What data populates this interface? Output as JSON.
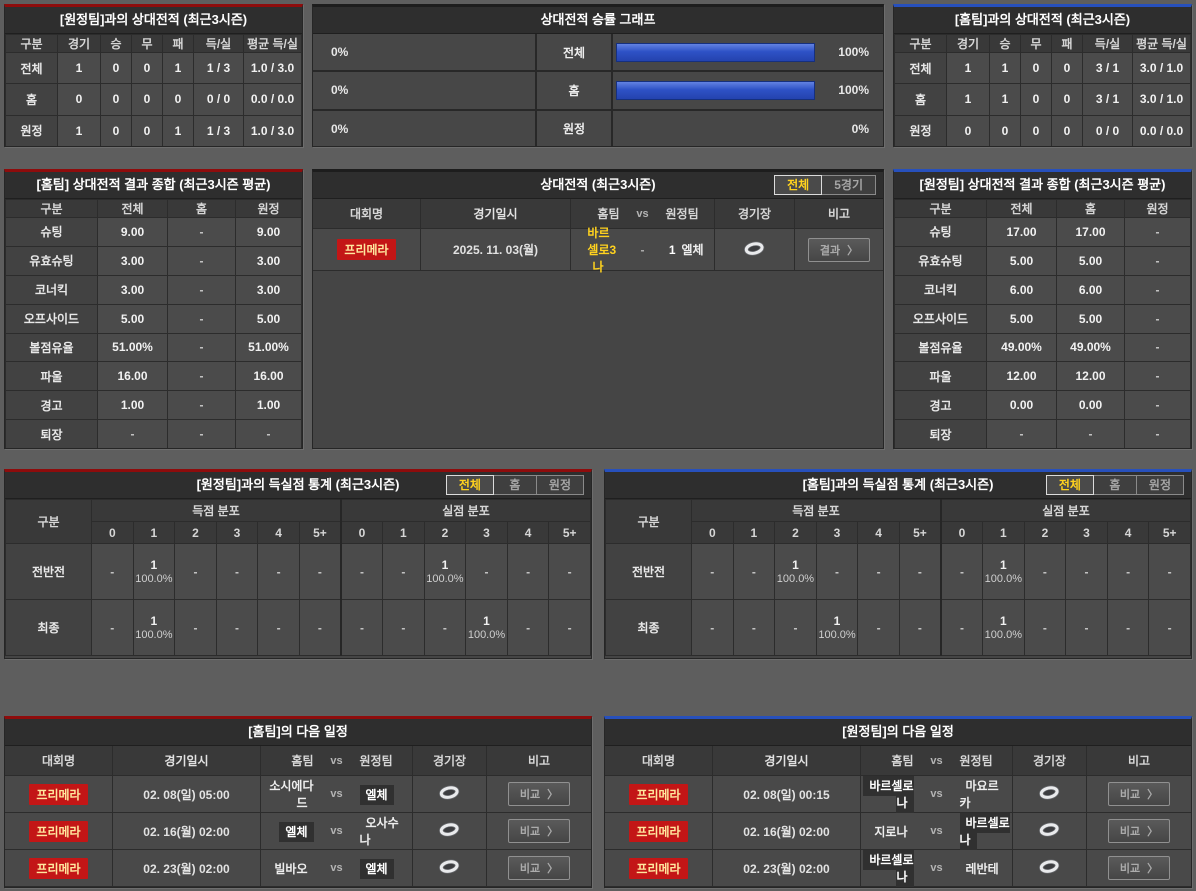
{
  "labels": {
    "vs": "vs",
    "arrow": "〉"
  },
  "colors": {
    "accent_red": "#8e0c0c",
    "accent_blue": "#2750bc",
    "highlight_yellow": "#ffd21e",
    "bar_blue": "#2e52c6",
    "badge_red": "#c31616"
  },
  "away_h2h": {
    "title": "[원정팀]과의 상대전적 (최근3시즌)",
    "columns": [
      "구분",
      "경기",
      "승",
      "무",
      "패",
      "득/실",
      "평균 득/실"
    ],
    "rows": [
      {
        "label": "전체",
        "values": [
          "1",
          "0",
          "0",
          "1",
          "1 / 3",
          "1.0 / 3.0"
        ]
      },
      {
        "label": "홈",
        "values": [
          "0",
          "0",
          "0",
          "0",
          "0 / 0",
          "0.0 / 0.0"
        ]
      },
      {
        "label": "원정",
        "values": [
          "1",
          "0",
          "0",
          "1",
          "1 / 3",
          "1.0 / 3.0"
        ]
      }
    ]
  },
  "winrate_graph": {
    "title": "상대전적 승률 그래프",
    "rows": [
      {
        "left_pct": "0%",
        "label": "전체",
        "right_pct": "100%",
        "left_value": 0,
        "right_value": 100
      },
      {
        "left_pct": "0%",
        "label": "홈",
        "right_pct": "100%",
        "left_value": 0,
        "right_value": 100
      },
      {
        "left_pct": "0%",
        "label": "원정",
        "right_pct": "0%",
        "left_value": 0,
        "right_value": 0
      }
    ]
  },
  "home_h2h": {
    "title": "[홈팀]과의 상대전적 (최근3시즌)",
    "columns": [
      "구분",
      "경기",
      "승",
      "무",
      "패",
      "득/실",
      "평균 득/실"
    ],
    "rows": [
      {
        "label": "전체",
        "values": [
          "1",
          "1",
          "0",
          "0",
          "3 / 1",
          "3.0 / 1.0"
        ]
      },
      {
        "label": "홈",
        "values": [
          "1",
          "1",
          "0",
          "0",
          "3 / 1",
          "3.0 / 1.0"
        ]
      },
      {
        "label": "원정",
        "values": [
          "0",
          "0",
          "0",
          "0",
          "0 / 0",
          "0.0 / 0.0"
        ]
      }
    ]
  },
  "home_summary": {
    "title": "[홈팀] 상대전적 결과 종합 (최근3시즌 평균)",
    "columns": [
      "구분",
      "전체",
      "홈",
      "원정"
    ],
    "rows": [
      {
        "label": "슈팅",
        "values": [
          "9.00",
          "-",
          "9.00"
        ]
      },
      {
        "label": "유효슈팅",
        "values": [
          "3.00",
          "-",
          "3.00"
        ]
      },
      {
        "label": "코너킥",
        "values": [
          "3.00",
          "-",
          "3.00"
        ]
      },
      {
        "label": "오프사이드",
        "values": [
          "5.00",
          "-",
          "5.00"
        ]
      },
      {
        "label": "볼점유율",
        "values": [
          "51.00%",
          "-",
          "51.00%"
        ]
      },
      {
        "label": "파울",
        "values": [
          "16.00",
          "-",
          "16.00"
        ]
      },
      {
        "label": "경고",
        "values": [
          "1.00",
          "-",
          "1.00"
        ]
      },
      {
        "label": "퇴장",
        "values": [
          "-",
          "-",
          "-"
        ]
      }
    ]
  },
  "h2h_matches": {
    "title": "상대전적 (최근3시즌)",
    "tabs": [
      {
        "label": "전체",
        "name": "tab-all",
        "active": true
      },
      {
        "label": "5경기",
        "name": "tab-5games",
        "active": false
      }
    ],
    "columns": {
      "league": "대회명",
      "datetime": "경기일시",
      "home": "홈팀",
      "vs": "vs",
      "away": "원정팀",
      "venue": "경기장",
      "note": "비고"
    },
    "rows": [
      {
        "league": "프리메라",
        "datetime": "2025. 11. 03(월)",
        "home": "바르셀로나",
        "home_win": true,
        "score": [
          "3",
          "-",
          "1"
        ],
        "away": "엘체",
        "away_win": false,
        "note": "결과"
      }
    ]
  },
  "away_summary": {
    "title": "[원정팀] 상대전적 결과 종합 (최근3시즌 평균)",
    "columns": [
      "구분",
      "전체",
      "홈",
      "원정"
    ],
    "rows": [
      {
        "label": "슈팅",
        "values": [
          "17.00",
          "17.00",
          "-"
        ]
      },
      {
        "label": "유효슈팅",
        "values": [
          "5.00",
          "5.00",
          "-"
        ]
      },
      {
        "label": "코너킥",
        "values": [
          "6.00",
          "6.00",
          "-"
        ]
      },
      {
        "label": "오프사이드",
        "values": [
          "5.00",
          "5.00",
          "-"
        ]
      },
      {
        "label": "볼점유율",
        "values": [
          "49.00%",
          "49.00%",
          "-"
        ]
      },
      {
        "label": "파울",
        "values": [
          "12.00",
          "12.00",
          "-"
        ]
      },
      {
        "label": "경고",
        "values": [
          "0.00",
          "0.00",
          "-"
        ]
      },
      {
        "label": "퇴장",
        "values": [
          "-",
          "-",
          "-"
        ]
      }
    ]
  },
  "away_goal_stats": {
    "title": "[원정팀]과의 득실점 통계 (최근3시즌)",
    "col_label": "구분",
    "tabs": [
      {
        "label": "전체",
        "name": "tab-all",
        "active": true
      },
      {
        "label": "홈",
        "name": "tab-home",
        "active": false
      },
      {
        "label": "원정",
        "name": "tab-away",
        "active": false
      }
    ],
    "group_headers": [
      "득점 분포",
      "실점 분포"
    ],
    "score_cols": [
      "0",
      "1",
      "2",
      "3",
      "4",
      "5+"
    ],
    "rows": [
      {
        "label": "전반전",
        "scored": [
          "-",
          {
            "count": "1",
            "pct": "100.0%"
          },
          "-",
          "-",
          "-",
          "-"
        ],
        "conceded": [
          "-",
          "-",
          {
            "count": "1",
            "pct": "100.0%"
          },
          "-",
          "-",
          "-"
        ]
      },
      {
        "label": "최종",
        "scored": [
          "-",
          {
            "count": "1",
            "pct": "100.0%"
          },
          "-",
          "-",
          "-",
          "-"
        ],
        "conceded": [
          "-",
          "-",
          "-",
          {
            "count": "1",
            "pct": "100.0%"
          },
          "-",
          "-"
        ]
      }
    ]
  },
  "home_goal_stats": {
    "title": "[홈팀]과의 득실점 통계 (최근3시즌)",
    "col_label": "구분",
    "tabs": [
      {
        "label": "전체",
        "name": "tab-all",
        "active": true
      },
      {
        "label": "홈",
        "name": "tab-home",
        "active": false
      },
      {
        "label": "원정",
        "name": "tab-away",
        "active": false
      }
    ],
    "group_headers": [
      "득점 분포",
      "실점 분포"
    ],
    "score_cols": [
      "0",
      "1",
      "2",
      "3",
      "4",
      "5+"
    ],
    "rows": [
      {
        "label": "전반전",
        "scored": [
          "-",
          "-",
          {
            "count": "1",
            "pct": "100.0%"
          },
          "-",
          "-",
          "-"
        ],
        "conceded": [
          "-",
          {
            "count": "1",
            "pct": "100.0%"
          },
          "-",
          "-",
          "-",
          "-"
        ]
      },
      {
        "label": "최종",
        "scored": [
          "-",
          "-",
          "-",
          {
            "count": "1",
            "pct": "100.0%"
          },
          "-",
          "-"
        ],
        "conceded": [
          "-",
          {
            "count": "1",
            "pct": "100.0%"
          },
          "-",
          "-",
          "-",
          "-"
        ]
      }
    ]
  },
  "home_schedule": {
    "title": "[홈팀]의 다음 일정",
    "columns": {
      "league": "대회명",
      "datetime": "경기일시",
      "home": "홈팀",
      "vs": "vs",
      "away": "원정팀",
      "venue": "경기장",
      "note": "비고"
    },
    "rows": [
      {
        "league": "프리메라",
        "datetime": "02. 08(일) 05:00",
        "home": "소시에다드",
        "away": "엘체",
        "highlight": "away",
        "note": "비교"
      },
      {
        "league": "프리메라",
        "datetime": "02. 16(월) 02:00",
        "home": "엘체",
        "away": "오사수나",
        "highlight": "home",
        "note": "비교"
      },
      {
        "league": "프리메라",
        "datetime": "02. 23(월) 02:00",
        "home": "빌바오",
        "away": "엘체",
        "highlight": "away",
        "note": "비교"
      }
    ]
  },
  "away_schedule": {
    "title": "[원정팀]의 다음 일정",
    "columns": {
      "league": "대회명",
      "datetime": "경기일시",
      "home": "홈팀",
      "vs": "vs",
      "away": "원정팀",
      "venue": "경기장",
      "note": "비고"
    },
    "rows": [
      {
        "league": "프리메라",
        "datetime": "02. 08(일) 00:15",
        "home": "바르셀로나",
        "away": "마요르카",
        "highlight": "home",
        "note": "비교"
      },
      {
        "league": "프리메라",
        "datetime": "02. 16(월) 02:00",
        "home": "지로나",
        "away": "바르셀로나",
        "highlight": "away",
        "note": "비교"
      },
      {
        "league": "프리메라",
        "datetime": "02. 23(월) 02:00",
        "home": "바르셀로나",
        "away": "레반테",
        "highlight": "home",
        "note": "비교"
      }
    ]
  }
}
